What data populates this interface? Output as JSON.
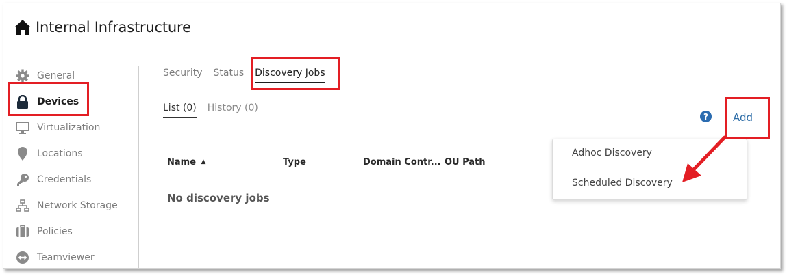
{
  "header": {
    "title": "Internal Infrastructure",
    "icon": "home-icon"
  },
  "sidebar": {
    "items": [
      {
        "label": "General",
        "icon": "gear-icon"
      },
      {
        "label": "Devices",
        "icon": "lock-icon",
        "active": true
      },
      {
        "label": "Virtualization",
        "icon": "monitor-icon"
      },
      {
        "label": "Locations",
        "icon": "location-pin-icon"
      },
      {
        "label": "Credentials",
        "icon": "key-icon"
      },
      {
        "label": "Network Storage",
        "icon": "network-icon"
      },
      {
        "label": "Policies",
        "icon": "briefcase-icon"
      },
      {
        "label": "Teamviewer",
        "icon": "teamviewer-icon"
      }
    ]
  },
  "tabs": {
    "items": [
      {
        "label": "Security"
      },
      {
        "label": "Status"
      },
      {
        "label": "Discovery Jobs",
        "active": true
      }
    ]
  },
  "subtabs": {
    "items": [
      {
        "label": "List (0)",
        "active": true
      },
      {
        "label": "History (0)"
      }
    ]
  },
  "toolbar": {
    "help_label": "?",
    "add_label": "Add"
  },
  "table": {
    "columns": [
      "Name",
      "Type",
      "Domain Contr...",
      "OU Path"
    ],
    "sort_indicator": "▲",
    "empty_message": "No discovery jobs"
  },
  "dropdown": {
    "options": [
      "Adhoc Discovery",
      "Scheduled Discovery"
    ]
  },
  "colors": {
    "highlight": "#e31e24",
    "link": "#2f6ea8",
    "help": "#2b6cb0"
  }
}
